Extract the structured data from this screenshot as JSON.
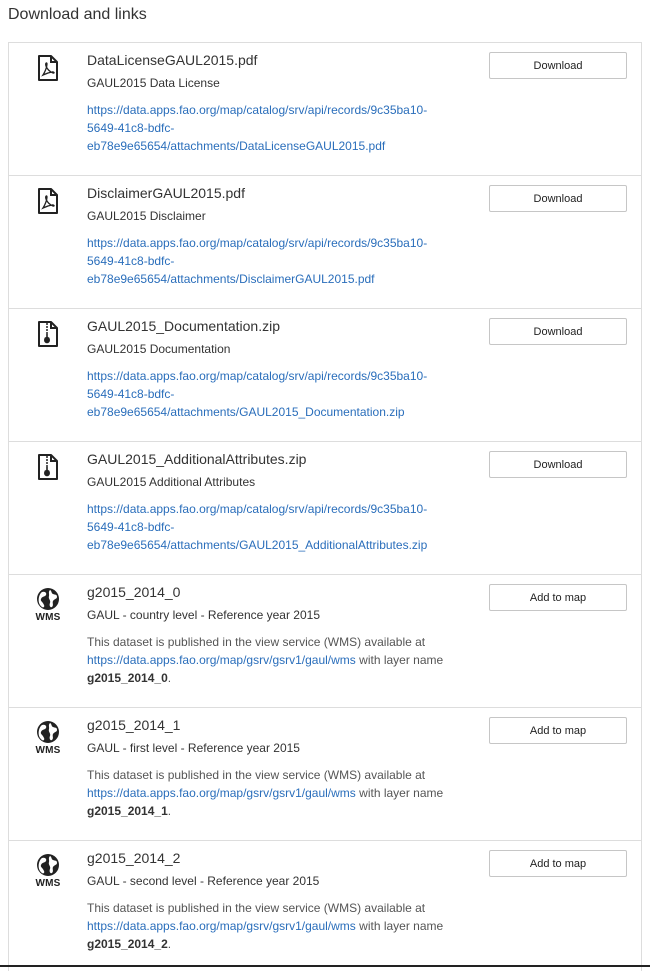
{
  "section_title": "Download and links",
  "items": [
    {
      "icon": "pdf-icon",
      "name": "DataLicenseGAUL2015.pdf",
      "description": "GAUL2015 Data License",
      "url": "https://data.apps.fao.org/map/catalog/srv/api/records/9c35ba10-5649-41c8-bdfc-eb78e9e65654/attachments/DataLicenseGAUL2015.pdf",
      "url_lines": [
        "https://data.apps.fao.org/map/catalog/srv/api/records/9c35ba10-",
        "5649-41c8-bdfc-",
        "eb78e9e65654/attachments/DataLicenseGAUL2015.pdf"
      ],
      "button_label": "Download"
    },
    {
      "icon": "pdf-icon",
      "name": "DisclaimerGAUL2015.pdf",
      "description": "GAUL2015 Disclaimer",
      "url": "https://data.apps.fao.org/map/catalog/srv/api/records/9c35ba10-5649-41c8-bdfc-eb78e9e65654/attachments/DisclaimerGAUL2015.pdf",
      "url_lines": [
        "https://data.apps.fao.org/map/catalog/srv/api/records/9c35ba10-",
        "5649-41c8-bdfc-",
        "eb78e9e65654/attachments/DisclaimerGAUL2015.pdf"
      ],
      "button_label": "Download"
    },
    {
      "icon": "zip-icon",
      "name": "GAUL2015_Documentation.zip",
      "description": "GAUL2015 Documentation",
      "url": "https://data.apps.fao.org/map/catalog/srv/api/records/9c35ba10-5649-41c8-bdfc-eb78e9e65654/attachments/GAUL2015_Documentation.zip",
      "url_lines": [
        "https://data.apps.fao.org/map/catalog/srv/api/records/9c35ba10-",
        "5649-41c8-bdfc-",
        "eb78e9e65654/attachments/GAUL2015_Documentation.zip"
      ],
      "button_label": "Download"
    },
    {
      "icon": "zip-icon",
      "name": "GAUL2015_AdditionalAttributes.zip",
      "description": "GAUL2015 Additional Attributes",
      "url": "https://data.apps.fao.org/map/catalog/srv/api/records/9c35ba10-5649-41c8-bdfc-eb78e9e65654/attachments/GAUL2015_AdditionalAttributes.zip",
      "url_lines": [
        "https://data.apps.fao.org/map/catalog/srv/api/records/9c35ba10-",
        "5649-41c8-bdfc-",
        "eb78e9e65654/attachments/GAUL2015_AdditionalAttributes.zip"
      ],
      "button_label": "Download"
    },
    {
      "icon": "globe-icon",
      "icon_label": "WMS",
      "name": "g2015_2014_0",
      "description": "GAUL - country level - Reference year 2015",
      "wms_prefix": "This dataset is published in the view service (WMS) available at",
      "wms_url": "https://data.apps.fao.org/map/gsrv/gsrv1/gaul/wms",
      "wms_middle": "with layer name",
      "layer_name": "g2015_2014_0",
      "wms_suffix": ".",
      "button_label": "Add to map"
    },
    {
      "icon": "globe-icon",
      "icon_label": "WMS",
      "name": "g2015_2014_1",
      "description": "GAUL - first level - Reference year 2015",
      "wms_prefix": "This dataset is published in the view service (WMS) available at",
      "wms_url": "https://data.apps.fao.org/map/gsrv/gsrv1/gaul/wms",
      "wms_middle": "with layer name",
      "layer_name": "g2015_2014_1",
      "wms_suffix": ".",
      "button_label": "Add to map"
    },
    {
      "icon": "globe-icon",
      "icon_label": "WMS",
      "name": "g2015_2014_2",
      "description": "GAUL - second level - Reference year 2015",
      "wms_prefix": "This dataset is published in the view service (WMS) available at",
      "wms_url": "https://data.apps.fao.org/map/gsrv/gsrv1/gaul/wms",
      "wms_middle": "with layer name",
      "layer_name": "g2015_2014_2",
      "wms_suffix": ".",
      "button_label": "Add to map"
    }
  ]
}
